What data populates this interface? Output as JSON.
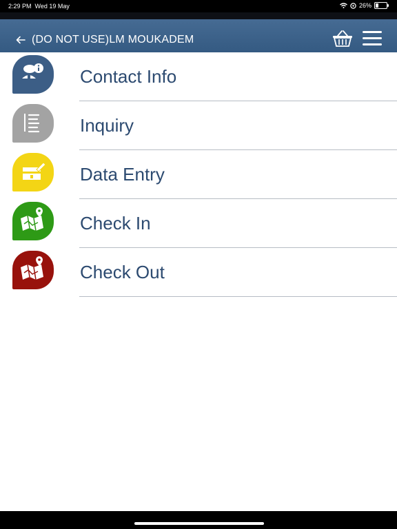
{
  "status_bar": {
    "time": "2:29 PM",
    "date": "Wed 19 May",
    "battery": "26%"
  },
  "header": {
    "title": "(DO NOT USE)LM  MOUKADEM",
    "back_icon": "back-arrow-icon",
    "basket_icon": "basket-icon",
    "menu_icon": "hamburger-menu-icon"
  },
  "menu": {
    "items": [
      {
        "label": "Contact Info",
        "icon": "contact-info-icon",
        "color": "#3c5e86"
      },
      {
        "label": "Inquiry",
        "icon": "inquiry-list-icon",
        "color": "#a3a3a3"
      },
      {
        "label": "Data Entry",
        "icon": "data-entry-icon",
        "color": "#f3d515"
      },
      {
        "label": "Check In",
        "icon": "check-in-map-icon",
        "color": "#2e9a16"
      },
      {
        "label": "Check Out",
        "icon": "check-out-map-icon",
        "color": "#98120c"
      }
    ]
  }
}
